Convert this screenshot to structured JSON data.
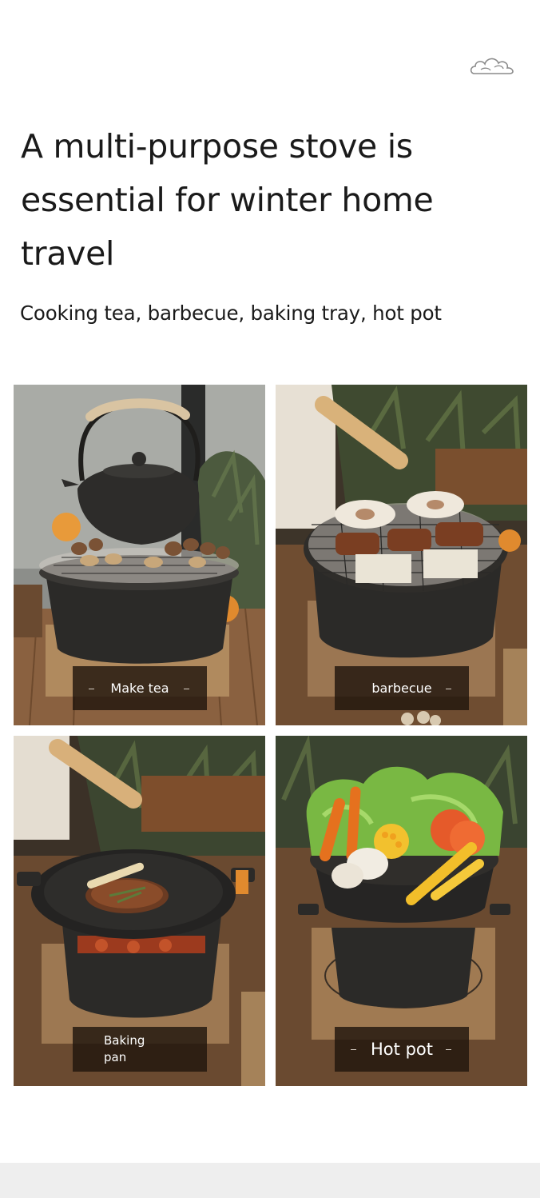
{
  "header": {
    "title": "A multi-purpose stove is essential for winter home travel",
    "subtitle": "Cooking tea, barbecue, baking tray, hot pot"
  },
  "tiles": [
    {
      "label": "Make tea",
      "icon": "teapot-on-grill-photo"
    },
    {
      "label": "barbecue",
      "icon": "barbecue-grill-photo"
    },
    {
      "label": "Baking pan",
      "icon": "baking-pan-photo"
    },
    {
      "label": "Hot pot",
      "icon": "hot-pot-photo"
    }
  ],
  "colors": {
    "label_background": "#21160e",
    "stove_iron": "#2b2a28",
    "wood": "#a07a52"
  }
}
